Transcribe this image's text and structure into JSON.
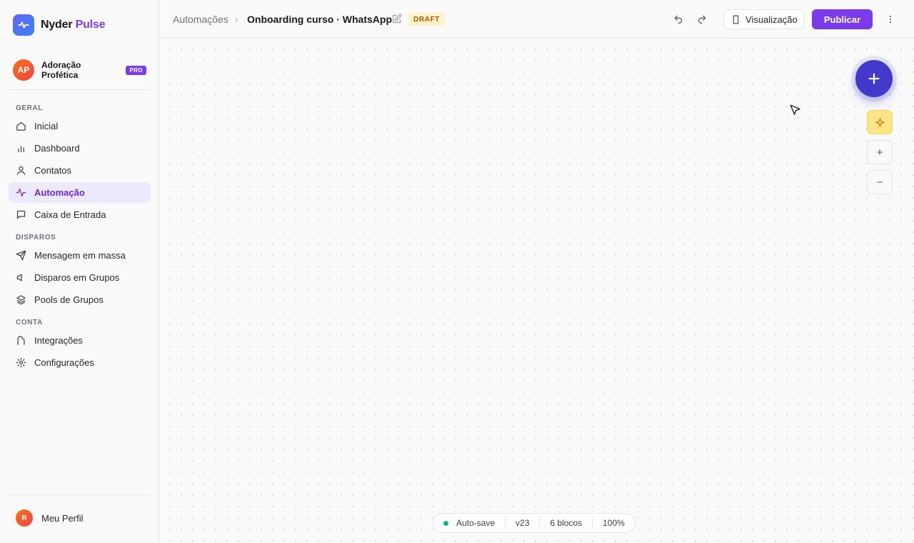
{
  "brand": {
    "name_main": "Nyder",
    "name_accent": "Pulse"
  },
  "workspace": {
    "initials": "AP",
    "name": "Adoração Profética",
    "badge": "PRO"
  },
  "sidebar": {
    "sections": [
      {
        "label": "GERAL",
        "items": [
          {
            "label": "Inicial",
            "icon": "home-icon"
          },
          {
            "label": "Dashboard",
            "icon": "bar-chart-icon"
          },
          {
            "label": "Contatos",
            "icon": "user-icon"
          },
          {
            "label": "Automação",
            "icon": "activity-icon",
            "active": true
          },
          {
            "label": "Caixa de Entrada",
            "icon": "message-icon"
          }
        ]
      },
      {
        "label": "DISPAROS",
        "items": [
          {
            "label": "Mensagem em massa",
            "icon": "send-icon"
          },
          {
            "label": "Disparos em Grupos",
            "icon": "megaphone-icon"
          },
          {
            "label": "Pools de Grupos",
            "icon": "layers-icon"
          }
        ]
      },
      {
        "label": "CONTA",
        "items": [
          {
            "label": "Integrações",
            "icon": "plug-icon"
          },
          {
            "label": "Configurações",
            "icon": "gear-icon"
          }
        ]
      }
    ],
    "profile": {
      "initial": "R",
      "label": "Meu Perfil"
    }
  },
  "header": {
    "breadcrumb_root": "Automações",
    "breadcrumb_sep": "›",
    "title": "Onboarding curso · WhatsApp",
    "status_badge": "DRAFT",
    "preview_label": "Visualização",
    "publish_label": "Publicar"
  },
  "status_bar": {
    "autosave": "Auto-save",
    "version": "v23",
    "blocks": "6 blocos",
    "zoom": "100%"
  },
  "colors": {
    "accent": "#7c3aed",
    "fab": "#4338ca",
    "draft_bg": "#fef3c7",
    "ai_button": "#fde68a",
    "status_ok": "#10b981"
  }
}
